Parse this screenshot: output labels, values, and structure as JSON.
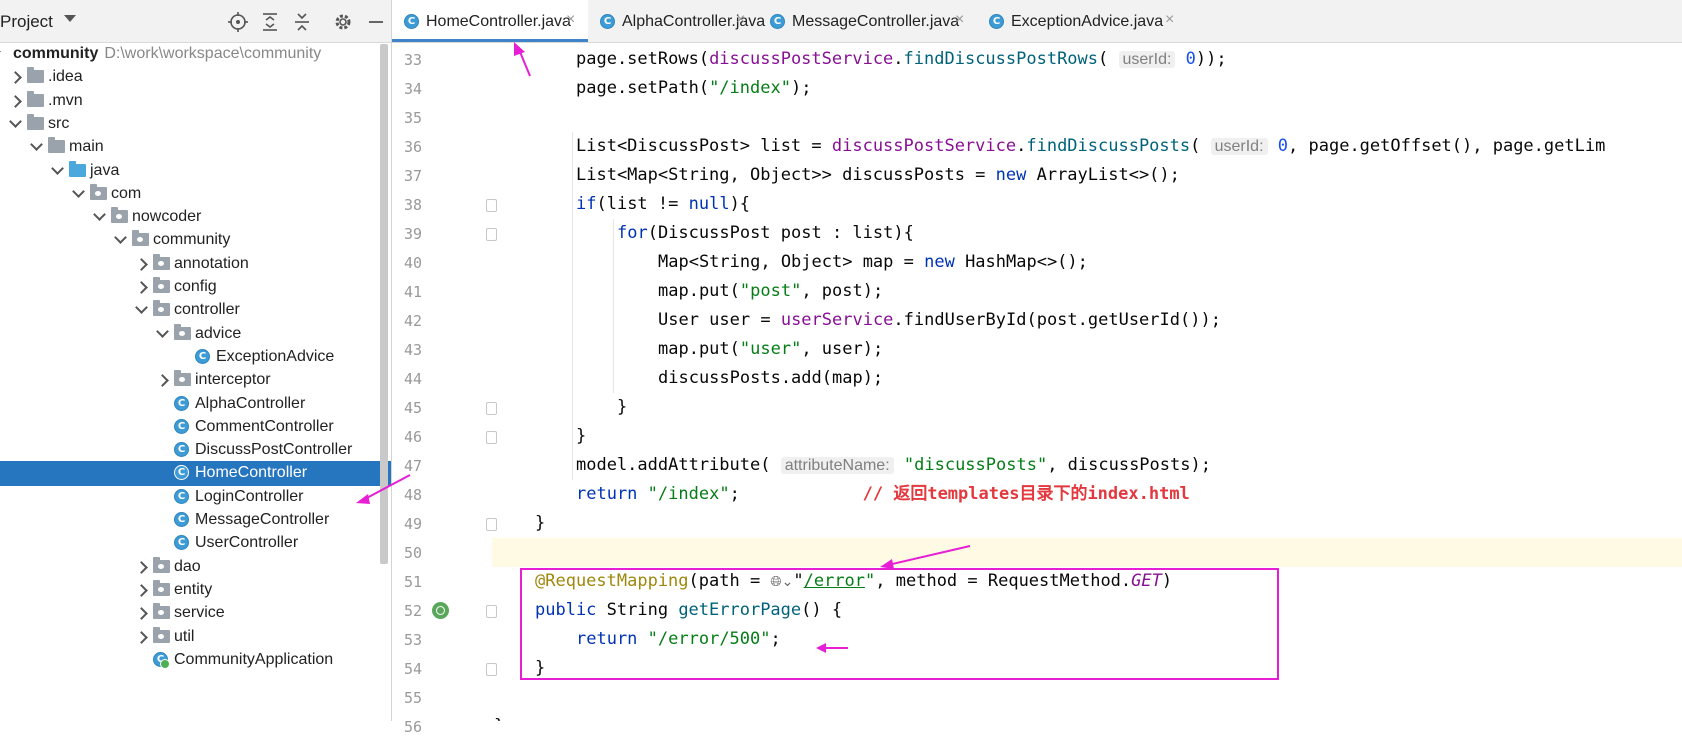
{
  "project_panel": {
    "title": "Project",
    "header_icons": [
      "locate-icon",
      "expand-all-icon",
      "collapse-all-icon",
      "gear-icon",
      "hide-icon"
    ],
    "tree": [
      {
        "label": "community",
        "path": "D:\\work\\workspace\\community",
        "kind": "root",
        "depth": 0,
        "expanded": true
      },
      {
        "label": ".idea",
        "kind": "folder",
        "depth": 1,
        "expanded": false
      },
      {
        "label": ".mvn",
        "kind": "folder",
        "depth": 1,
        "expanded": false
      },
      {
        "label": "src",
        "kind": "folder",
        "depth": 1,
        "expanded": true
      },
      {
        "label": "main",
        "kind": "folder",
        "depth": 2,
        "expanded": true
      },
      {
        "label": "java",
        "kind": "source-root",
        "depth": 3,
        "expanded": true
      },
      {
        "label": "com",
        "kind": "package",
        "depth": 4,
        "expanded": true
      },
      {
        "label": "nowcoder",
        "kind": "package",
        "depth": 5,
        "expanded": true
      },
      {
        "label": "community",
        "kind": "package",
        "depth": 6,
        "expanded": true
      },
      {
        "label": "annotation",
        "kind": "package",
        "depth": 7,
        "expanded": false
      },
      {
        "label": "config",
        "kind": "package",
        "depth": 7,
        "expanded": false
      },
      {
        "label": "controller",
        "kind": "package",
        "depth": 7,
        "expanded": true
      },
      {
        "label": "advice",
        "kind": "package",
        "depth": 8,
        "expanded": true
      },
      {
        "label": "ExceptionAdvice",
        "kind": "class",
        "depth": 9
      },
      {
        "label": "interceptor",
        "kind": "package",
        "depth": 8,
        "expanded": false
      },
      {
        "label": "AlphaController",
        "kind": "class",
        "depth": 8
      },
      {
        "label": "CommentController",
        "kind": "class",
        "depth": 8
      },
      {
        "label": "DiscussPostController",
        "kind": "class",
        "depth": 8
      },
      {
        "label": "HomeController",
        "kind": "class",
        "depth": 8,
        "selected": true
      },
      {
        "label": "LoginController",
        "kind": "class",
        "depth": 8
      },
      {
        "label": "MessageController",
        "kind": "class",
        "depth": 8
      },
      {
        "label": "UserController",
        "kind": "class",
        "depth": 8
      },
      {
        "label": "dao",
        "kind": "package",
        "depth": 7,
        "expanded": false
      },
      {
        "label": "entity",
        "kind": "package",
        "depth": 7,
        "expanded": false
      },
      {
        "label": "service",
        "kind": "package",
        "depth": 7,
        "expanded": false
      },
      {
        "label": "util",
        "kind": "package",
        "depth": 7,
        "expanded": false
      },
      {
        "label": "CommunityApplication",
        "kind": "app-class",
        "depth": 7
      }
    ]
  },
  "tabs": [
    {
      "label": "HomeController.java",
      "active": true
    },
    {
      "label": "AlphaController.java",
      "active": false
    },
    {
      "label": "MessageController.java",
      "active": false
    },
    {
      "label": "ExceptionAdvice.java",
      "active": false
    }
  ],
  "tab_close_glyph": "×",
  "class_icon_glyph": "C",
  "editor": {
    "lines": [
      {
        "no": "33",
        "tokens": [
          {
            "t": "page.setRows("
          },
          {
            "t": "discussPostService",
            "c": "field"
          },
          {
            "t": "."
          },
          {
            "t": "findDiscussPostRows",
            "c": "meth"
          },
          {
            "t": "( "
          },
          {
            "t": "userId:",
            "c": "hint"
          },
          {
            "t": " "
          },
          {
            "t": "0",
            "c": "num"
          },
          {
            "t": "));"
          }
        ]
      },
      {
        "no": "34",
        "tokens": [
          {
            "t": "page.setPath("
          },
          {
            "t": "\"/index\"",
            "c": "str"
          },
          {
            "t": ");"
          }
        ]
      },
      {
        "no": "35",
        "tokens": []
      },
      {
        "no": "36",
        "tokens": [
          {
            "t": "List<DiscussPost> list = "
          },
          {
            "t": "discussPostService",
            "c": "field"
          },
          {
            "t": "."
          },
          {
            "t": "findDiscussPosts",
            "c": "meth"
          },
          {
            "t": "( "
          },
          {
            "t": "userId:",
            "c": "hint"
          },
          {
            "t": " "
          },
          {
            "t": "0",
            "c": "num"
          },
          {
            "t": ", page.getOffset(), page.getLim"
          }
        ]
      },
      {
        "no": "37",
        "tokens": [
          {
            "t": "List<Map<String, Object>> discussPosts = "
          },
          {
            "t": "new",
            "c": "kw"
          },
          {
            "t": " ArrayList<>();"
          }
        ]
      },
      {
        "no": "38",
        "tokens": [
          {
            "t": "if",
            "c": "kw"
          },
          {
            "t": "(list != "
          },
          {
            "t": "null",
            "c": "kw"
          },
          {
            "t": "){"
          }
        ]
      },
      {
        "no": "39",
        "tokens": [
          {
            "t": "for",
            "c": "kw"
          },
          {
            "t": "(DiscussPost post : list){"
          }
        ]
      },
      {
        "no": "40",
        "tokens": [
          {
            "t": "Map<String, Object> map = "
          },
          {
            "t": "new",
            "c": "kw"
          },
          {
            "t": " HashMap<>();"
          }
        ]
      },
      {
        "no": "41",
        "tokens": [
          {
            "t": "map.put("
          },
          {
            "t": "\"post\"",
            "c": "str"
          },
          {
            "t": ", post);"
          }
        ]
      },
      {
        "no": "42",
        "tokens": [
          {
            "t": "User user = "
          },
          {
            "t": "userService",
            "c": "field"
          },
          {
            "t": ".findUserById(post.getUserId());"
          }
        ]
      },
      {
        "no": "43",
        "tokens": [
          {
            "t": "map.put("
          },
          {
            "t": "\"user\"",
            "c": "str"
          },
          {
            "t": ", user);"
          }
        ]
      },
      {
        "no": "44",
        "tokens": [
          {
            "t": "discussPosts.add(map);"
          }
        ]
      },
      {
        "no": "45",
        "tokens": [
          {
            "t": "}"
          }
        ]
      },
      {
        "no": "46",
        "tokens": [
          {
            "t": "}"
          }
        ]
      },
      {
        "no": "47",
        "tokens": [
          {
            "t": "model.addAttribute( "
          },
          {
            "t": "attributeName:",
            "c": "hint"
          },
          {
            "t": " "
          },
          {
            "t": "\"discussPosts\"",
            "c": "str"
          },
          {
            "t": ", discussPosts);"
          }
        ]
      },
      {
        "no": "48",
        "tokens": [
          {
            "t": "return",
            "c": "kw"
          },
          {
            "t": " "
          },
          {
            "t": "\"/index\"",
            "c": "str"
          },
          {
            "t": ";            "
          },
          {
            "t": "// 返回templates目录下的index.html",
            "c": "cmt"
          }
        ]
      },
      {
        "no": "49",
        "tokens": [
          {
            "t": "}"
          }
        ]
      },
      {
        "no": "50",
        "tokens": [],
        "current": true
      },
      {
        "no": "51",
        "tokens": [
          {
            "t": "@RequestMapping",
            "c": "anno"
          },
          {
            "t": "(path = "
          },
          {
            "t": "🌐︎⌄",
            "c": "globe"
          },
          {
            "t": "\""
          },
          {
            "t": "/error",
            "c": "str link"
          },
          {
            "t": "\"",
            "c": "str"
          },
          {
            "t": ", method = RequestMethod."
          },
          {
            "t": "GET",
            "c": "italic"
          },
          {
            "t": ")"
          }
        ]
      },
      {
        "no": "52",
        "tokens": [
          {
            "t": "public",
            "c": "kw"
          },
          {
            "t": " String "
          },
          {
            "t": "getErrorPage",
            "c": "meth"
          },
          {
            "t": "() {"
          }
        ]
      },
      {
        "no": "53",
        "tokens": [
          {
            "t": "return",
            "c": "kw"
          },
          {
            "t": " "
          },
          {
            "t": "\"/error/500\"",
            "c": "str"
          },
          {
            "t": ";"
          }
        ]
      },
      {
        "no": "54",
        "tokens": [
          {
            "t": "}"
          }
        ]
      },
      {
        "no": "55",
        "tokens": []
      },
      {
        "no": "56",
        "tokens": [
          {
            "t": "}"
          }
        ]
      }
    ]
  },
  "colors": {
    "selection": "#2675bf",
    "annotation_arrows": "#e61fd5",
    "highlight_box": "#e61fd5",
    "current_line": "#fffae3"
  }
}
